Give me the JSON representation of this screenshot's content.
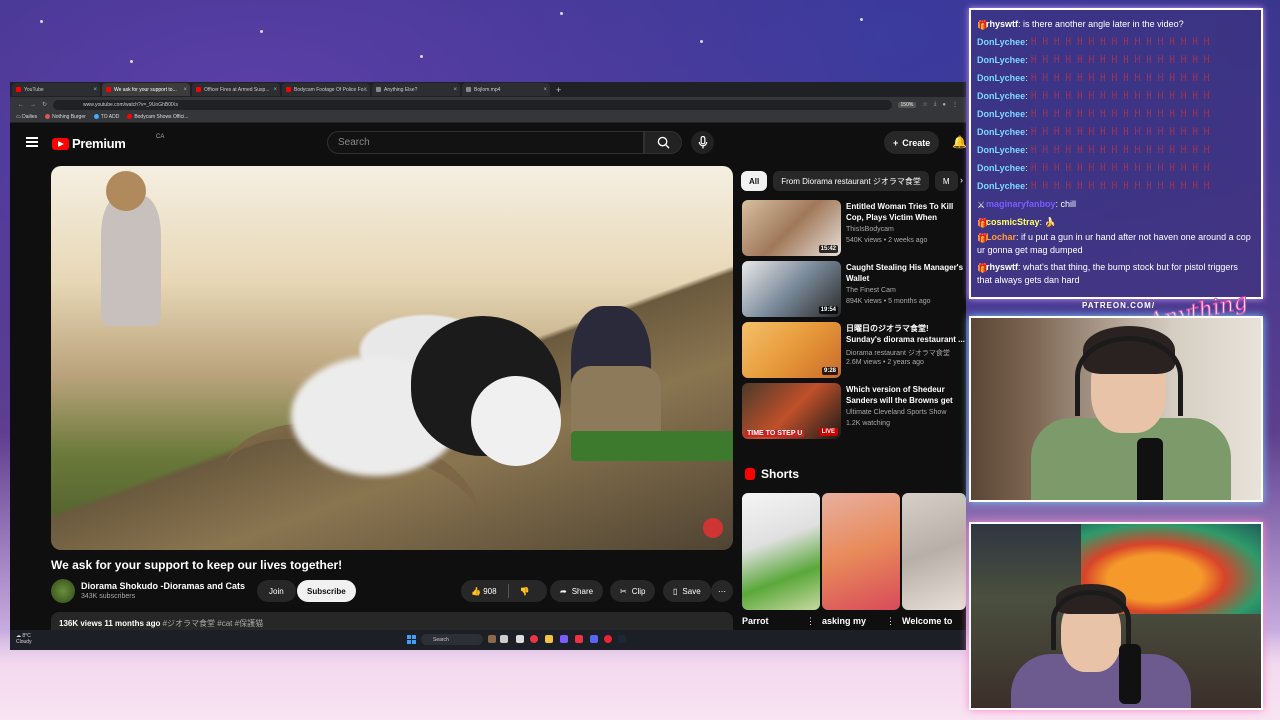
{
  "browser": {
    "tabs": [
      {
        "label": "YouTube",
        "active": false
      },
      {
        "label": "We ask for your support to...",
        "active": true
      },
      {
        "label": "Officer Fires at Armed Susp...",
        "active": false
      },
      {
        "label": "Bodycam Footage Of Police Fo...",
        "active": false
      },
      {
        "label": "Anything Else?",
        "active": false
      },
      {
        "label": "Bojlom.mp4",
        "active": false
      }
    ],
    "url": "www.youtube.com/watch?v=_9UoGhB0lXs",
    "zoom": "150%",
    "bookmarks": [
      "Dailies",
      "Nothing Burger",
      "TO ADD",
      "Bodycam Shows Offici..."
    ]
  },
  "youtube": {
    "logo_text": "Premium",
    "region": "CA",
    "search_placeholder": "Search",
    "create_label": "Create",
    "video": {
      "title": "We ask for your support to keep our lives together!",
      "channel": "Diorama Shokudo -Dioramas and Cats",
      "subscribers": "343K subscribers",
      "join_label": "Join",
      "subscribe_label": "Subscribe",
      "likes": "908",
      "share_label": "Share",
      "clip_label": "Clip",
      "save_label": "Save",
      "views_date": "136K views  11 months ago",
      "tags": "#ジオラマ食堂 #cat #保護猫"
    },
    "chips": [
      "All",
      "From Diorama restaurant ジオラマ食堂",
      "M"
    ],
    "recommendations": [
      {
        "title": "Entitled Woman Tries To Kill Cop, Plays Victim When Caught",
        "channel": "ThisIsBodycam",
        "meta": "540K views • 2 weeks ago",
        "duration": "15:42",
        "live": false
      },
      {
        "title": "Caught Stealing His Manager's Wallet",
        "channel": "The Finest Cam",
        "meta": "894K views • 5 months ago",
        "duration": "19:54",
        "live": false
      },
      {
        "title": "日曜日のジオラマ食堂! Sunday's diorama restaurant ...",
        "channel": "Diorama restaurant ジオラマ食堂",
        "meta": "2.6M views • 2 years ago",
        "duration": "9:28",
        "live": false
      },
      {
        "title": "Which version of Shedeur Sanders will the Browns get vs...",
        "channel": "Ultimate Cleveland Sports Show",
        "meta": "1.2K watching",
        "duration": "LIVE",
        "live": true,
        "thumb_text": "TIME TO STEP U"
      }
    ],
    "shorts_label": "Shorts",
    "shorts": [
      {
        "title": "Parrot"
      },
      {
        "title": "asking my"
      },
      {
        "title": "Welcome to"
      }
    ]
  },
  "taskbar": {
    "temp": "8°C",
    "weather": "Cloudy",
    "search": "Search"
  },
  "chat": {
    "messages": [
      {
        "user": "rhyswtf",
        "color": "#ffffff",
        "text": "is there another angle later in the video?",
        "wrap": false
      },
      {
        "user": "DonLychee",
        "color": "#7cd8ff",
        "text": "ꀿ ꀿ ꀿ ꀿ ꀿ ꀿ ꀿ ꀿ ꀿ ꀿ ꀿ ꀿ ꀿ ꀿ ꀿ ꀿ",
        "spam": true
      },
      {
        "user": "DonLychee",
        "color": "#7cd8ff",
        "text": "ꀿ ꀿ ꀿ ꀿ ꀿ ꀿ ꀿ ꀿ ꀿ ꀿ ꀿ ꀿ ꀿ ꀿ ꀿ ꀿ",
        "spam": true
      },
      {
        "user": "DonLychee",
        "color": "#7cd8ff",
        "text": "ꀿ ꀿ ꀿ ꀿ ꀿ ꀿ ꀿ ꀿ ꀿ ꀿ ꀿ ꀿ ꀿ ꀿ ꀿ ꀿ",
        "spam": true
      },
      {
        "user": "DonLychee",
        "color": "#7cd8ff",
        "text": "ꀿ ꀿ ꀿ ꀿ ꀿ ꀿ ꀿ ꀿ ꀿ ꀿ ꀿ ꀿ ꀿ ꀿ ꀿ ꀿ",
        "spam": true
      },
      {
        "user": "DonLychee",
        "color": "#7cd8ff",
        "text": "ꀿ ꀿ ꀿ ꀿ ꀿ ꀿ ꀿ ꀿ ꀿ ꀿ ꀿ ꀿ ꀿ ꀿ ꀿ ꀿ",
        "spam": true
      },
      {
        "user": "DonLychee",
        "color": "#7cd8ff",
        "text": "ꀿ ꀿ ꀿ ꀿ ꀿ ꀿ ꀿ ꀿ ꀿ ꀿ ꀿ ꀿ ꀿ ꀿ ꀿ ꀿ",
        "spam": true
      },
      {
        "user": "DonLychee",
        "color": "#7cd8ff",
        "text": "ꀿ ꀿ ꀿ ꀿ ꀿ ꀿ ꀿ ꀿ ꀿ ꀿ ꀿ ꀿ ꀿ ꀿ ꀿ ꀿ",
        "spam": true
      },
      {
        "user": "DonLychee",
        "color": "#7cd8ff",
        "text": "ꀿ ꀿ ꀿ ꀿ ꀿ ꀿ ꀿ ꀿ ꀿ ꀿ ꀿ ꀿ ꀿ ꀿ ꀿ ꀿ",
        "spam": true
      },
      {
        "user": "DonLychee",
        "color": "#7cd8ff",
        "text": "ꀿ ꀿ ꀿ ꀿ ꀿ ꀿ ꀿ ꀿ ꀿ ꀿ ꀿ ꀿ ꀿ ꀿ ꀿ ꀿ",
        "spam": true
      },
      {
        "user": "maginaryfanboy",
        "color": "#7a5cff",
        "text": "chill",
        "wrap": false
      },
      {
        "user": "cosmicStray",
        "color": "#ffff66",
        "text": "🍌",
        "wrap": false
      },
      {
        "user": "Lochar",
        "color": "#ff9a3c",
        "text": "if u put a gun in ur hand after not haven one around a cop ur gonna get mag dumped",
        "wrap": true
      },
      {
        "user": "rhyswtf",
        "color": "#ffffff",
        "text": "what's that thing, the bump stock but for pistol triggers that always gets dan hard",
        "wrap": true
      }
    ]
  },
  "overlay": {
    "patreon": "PATREON.COM/",
    "brand": "Anything Else?"
  }
}
